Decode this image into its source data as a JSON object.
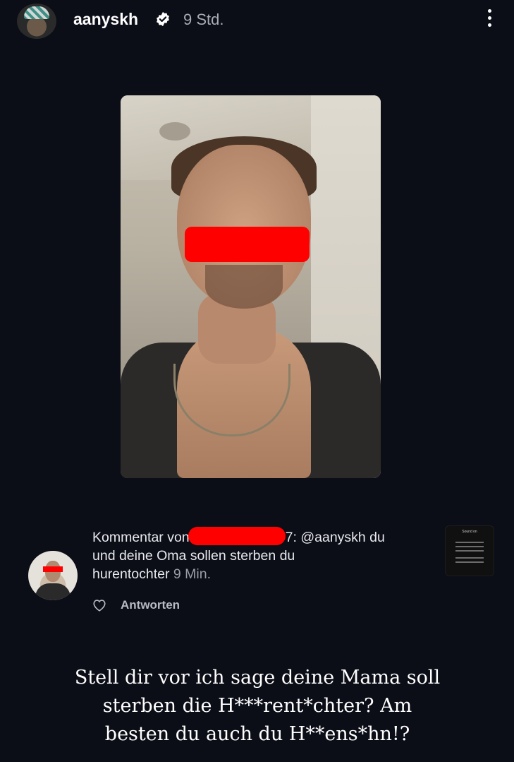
{
  "post": {
    "username": "aanyskh",
    "time": "9 Std.",
    "verified": true,
    "more_icon": "more-vertical-icon"
  },
  "comment": {
    "prefix": "Kommentar von",
    "after_censor": "7: @aanyskh du",
    "line2": "und deine Oma sollen sterben du",
    "line3": "hurentochter",
    "time": "9 Min.",
    "reply_label": "Antworten",
    "thumb_label": "Sound on"
  },
  "caption": {
    "line1": "Stell dir vor ich sage deine Mama soll",
    "line2": "sterben die H***rent*chter? Am",
    "line3": "besten du auch du H**ens*hn!?"
  },
  "colors": {
    "background": "#0b0d17",
    "censor": "#ff0000",
    "muted_text": "#a9acb6"
  }
}
